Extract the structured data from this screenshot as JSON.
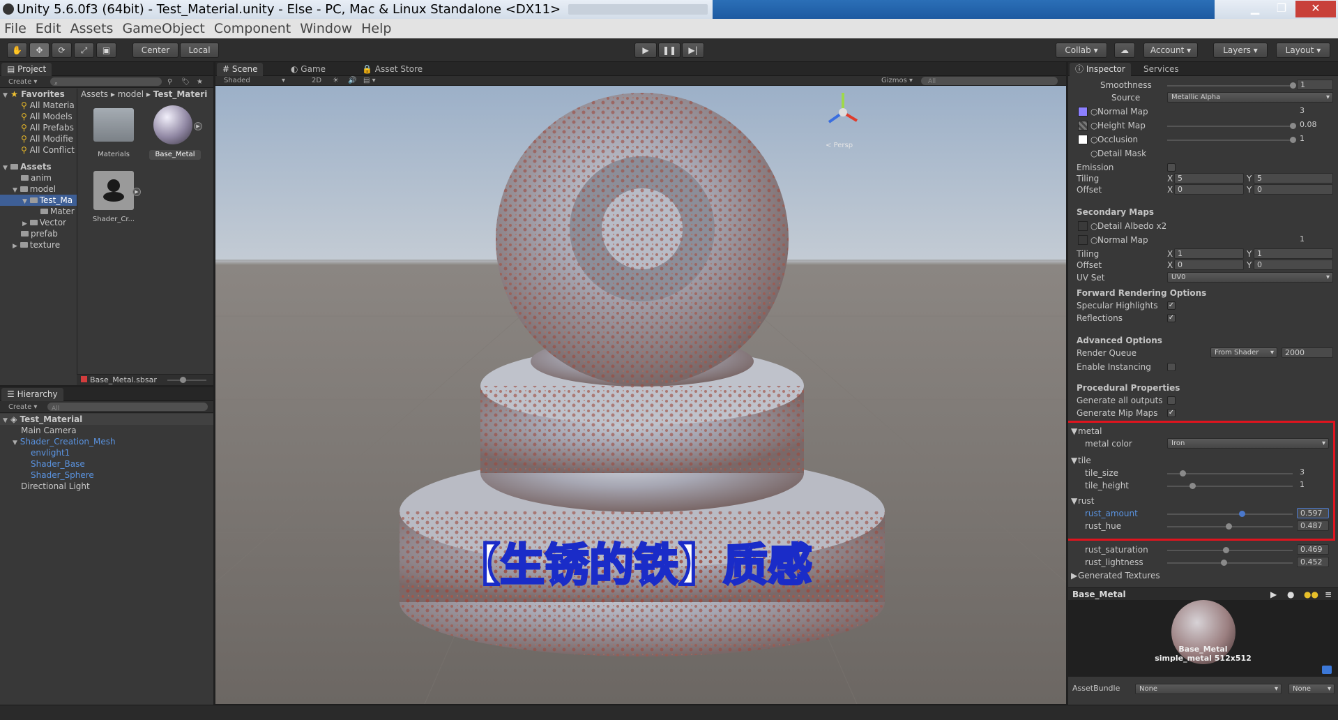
{
  "window": {
    "title": "Unity 5.6.0f3 (64bit) - Test_Material.unity - Else - PC, Mac & Linux Standalone <DX11>"
  },
  "menu": [
    "File",
    "Edit",
    "Assets",
    "GameObject",
    "Component",
    "Window",
    "Help"
  ],
  "toolbar": {
    "center": "Center",
    "local": "Local",
    "collab": "Collab",
    "account": "Account",
    "layers": "Layers",
    "layout": "Layout"
  },
  "project": {
    "tab": "Project",
    "create": "Create",
    "favorites_label": "Favorites",
    "favorites": [
      "All Materia",
      "All Models",
      "All Prefabs",
      "All Modifie",
      "All Conflict"
    ],
    "assets_label": "Assets",
    "assets": [
      "anim",
      "model",
      "Test_Ma",
      "Mater",
      "Vector",
      "prefab",
      "texture"
    ],
    "breadcrumb": [
      "Assets",
      "model",
      "Test_Materi"
    ],
    "items": [
      "Materials",
      "Base_Metal",
      "Shader_Cr..."
    ],
    "footer_file": "Base_Metal.sbsar"
  },
  "hierarchy": {
    "tab": "Hierarchy",
    "create": "Create",
    "search_placeholder": "All",
    "scene": "Test_Material",
    "items": [
      "Main Camera",
      "Shader_Creation_Mesh",
      "envlight1",
      "Shader_Base",
      "Shader_Sphere",
      "Directional Light"
    ]
  },
  "scene": {
    "tabs": [
      "Scene",
      "Game",
      "Asset Store"
    ],
    "shaded": "Shaded",
    "mode2d": "2D",
    "gizmos": "Gizmos",
    "search_placeholder": "All",
    "persp": "< Persp",
    "caption": "【生锈的铁】质感"
  },
  "inspector": {
    "tabs": [
      "Inspector",
      "Services"
    ],
    "smoothness": {
      "label": "Smoothness",
      "value": "1",
      "fraction": 1.0
    },
    "source": {
      "label": "Source",
      "value": "Metallic Alpha"
    },
    "normal_map": {
      "label": "Normal Map",
      "value": "3"
    },
    "height_map": {
      "label": "Height Map",
      "value": "0.08",
      "fraction": 1.0
    },
    "occlusion": {
      "label": "Occlusion",
      "value": "1",
      "fraction": 1.0
    },
    "detail_mask": {
      "label": "Detail Mask"
    },
    "emission": {
      "label": "Emission"
    },
    "tiling": {
      "label": "Tiling",
      "x_label": "X",
      "x": "5",
      "y_label": "Y",
      "y": "5"
    },
    "offset": {
      "label": "Offset",
      "x_label": "X",
      "x": "0",
      "y_label": "Y",
      "y": "0"
    },
    "secondary_maps": "Secondary Maps",
    "detail_albedo": "Detail Albedo x2",
    "normal_map2": {
      "label": "Normal Map",
      "value": "1"
    },
    "tiling2": {
      "label": "Tiling",
      "x_label": "X",
      "x": "1",
      "y_label": "Y",
      "y": "1"
    },
    "offset2": {
      "label": "Offset",
      "x_label": "X",
      "x": "0",
      "y_label": "Y",
      "y": "0"
    },
    "uv_set": {
      "label": "UV Set",
      "value": "UV0"
    },
    "forward_rendering": "Forward Rendering Options",
    "specular_highlights": {
      "label": "Specular Highlights",
      "checked": true
    },
    "reflections": {
      "label": "Reflections",
      "checked": true
    },
    "advanced": "Advanced Options",
    "render_queue": {
      "label": "Render Queue",
      "mode": "From Shader",
      "value": "2000"
    },
    "enable_instancing": {
      "label": "Enable Instancing",
      "checked": false
    },
    "procedural": "Procedural Properties",
    "generate_outputs": {
      "label": "Generate all outputs",
      "checked": false
    },
    "generate_mips": {
      "label": "Generate Mip Maps",
      "checked": true
    },
    "metal_group": "metal",
    "metal_color": {
      "label": "metal color",
      "value": "Iron"
    },
    "tile_group": "tile",
    "tile_size": {
      "label": "tile_size",
      "value": "3",
      "fraction": 0.12
    },
    "tile_height": {
      "label": "tile_height",
      "value": "1",
      "fraction": 0.2
    },
    "rust_group": "rust",
    "rust_amount": {
      "label": "rust_amount",
      "value": "0.597",
      "fraction": 0.597
    },
    "rust_hue": {
      "label": "rust_hue",
      "value": "0.487",
      "fraction": 0.487
    },
    "rust_saturation": {
      "label": "rust_saturation",
      "value": "0.469",
      "fraction": 0.469
    },
    "rust_lightness": {
      "label": "rust_lightness",
      "value": "0.452",
      "fraction": 0.452
    },
    "generated_textures": "Generated Textures",
    "preview_title": "Base_Metal",
    "preview_name": "Base_Metal",
    "preview_info": "simple_metal   512x512",
    "assetbundle": {
      "label": "AssetBundle",
      "value1": "None",
      "value2": "None"
    }
  },
  "colors": {
    "highlight_box": "#e0141e",
    "accent_blue": "#5a93e0",
    "caption_fill": "#ffffff",
    "caption_stroke": "#1a2cc8"
  }
}
